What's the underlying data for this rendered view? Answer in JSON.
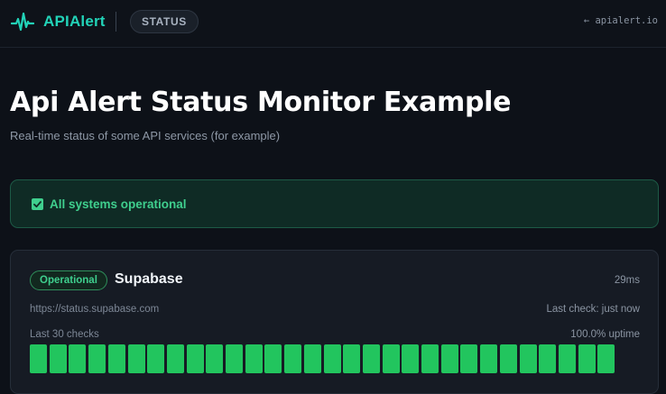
{
  "header": {
    "brand": "APIAlert",
    "status_pill": "STATUS",
    "back_link": "← apialert.io",
    "brand_color": "#22d3b8"
  },
  "page": {
    "title": "Api Alert Status Monitor Example",
    "subtitle": "Real-time status of some API services (for example)"
  },
  "banner": {
    "text": "All systems operational",
    "color": "#3fcf8e"
  },
  "services": [
    {
      "state": "Operational",
      "name": "Supabase",
      "latency": "29ms",
      "url": "https://status.supabase.com",
      "last_check": "Last check: just now",
      "checks_label": "Last 30 checks",
      "uptime": "100.0% uptime",
      "checks": [
        "up",
        "up",
        "up",
        "up",
        "up",
        "up",
        "up",
        "up",
        "up",
        "up",
        "up",
        "up",
        "up",
        "up",
        "up",
        "up",
        "up",
        "up",
        "up",
        "up",
        "up",
        "up",
        "up",
        "up",
        "up",
        "up",
        "up",
        "up",
        "up",
        "up"
      ],
      "up_color": "#22c55e"
    }
  ]
}
